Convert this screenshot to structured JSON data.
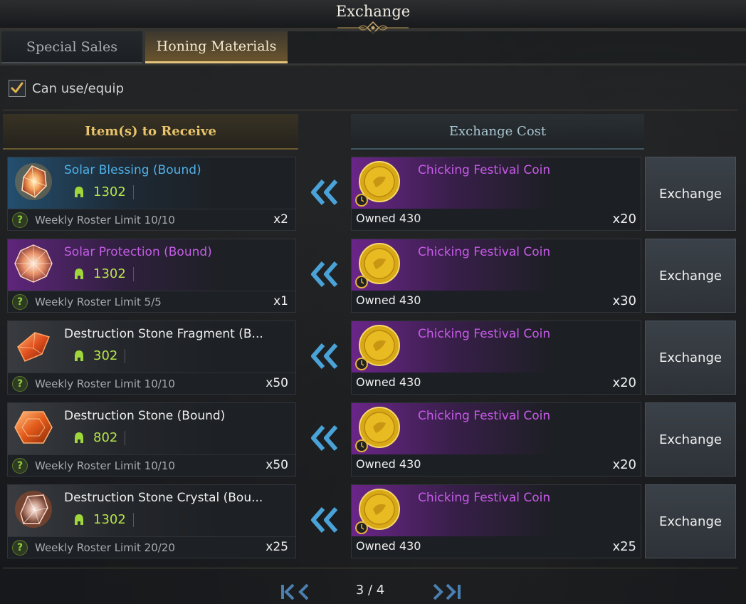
{
  "window": {
    "title": "Exchange"
  },
  "tabs": [
    {
      "label": "Special Sales",
      "active": false
    },
    {
      "label": "Honing Materials",
      "active": true
    }
  ],
  "filter": {
    "label": "Can use/equip",
    "checked": true
  },
  "headers": {
    "receive": "Item(s) to Receive",
    "cost": "Exchange Cost"
  },
  "rows": [
    {
      "item_name": "Solar Blessing (Bound)",
      "name_color": "blue",
      "item_level": "1302",
      "limit": "Weekly Roster Limit 10/10",
      "qty": "x2",
      "icon": "solar-blessing-icon",
      "cost_name": "Chicking Festival Coin",
      "owned": "Owned 430",
      "cost_qty": "x20",
      "button": "Exchange"
    },
    {
      "item_name": "Solar Protection (Bound)",
      "name_color": "purple",
      "item_level": "1302",
      "limit": "Weekly Roster Limit 5/5",
      "qty": "x1",
      "icon": "solar-protection-icon",
      "cost_name": "Chicking Festival Coin",
      "owned": "Owned 430",
      "cost_qty": "x30",
      "button": "Exchange"
    },
    {
      "item_name": "Destruction Stone Fragment (B...",
      "name_color": "white",
      "item_level": "302",
      "limit": "Weekly Roster Limit 10/10",
      "qty": "x50",
      "icon": "destruction-stone-fragment-icon",
      "cost_name": "Chicking Festival Coin",
      "owned": "Owned 430",
      "cost_qty": "x20",
      "button": "Exchange"
    },
    {
      "item_name": "Destruction Stone (Bound)",
      "name_color": "white",
      "item_level": "802",
      "limit": "Weekly Roster Limit 10/10",
      "qty": "x50",
      "icon": "destruction-stone-icon",
      "cost_name": "Chicking Festival Coin",
      "owned": "Owned 430",
      "cost_qty": "x20",
      "button": "Exchange"
    },
    {
      "item_name": "Destruction Stone Crystal (Bou...",
      "name_color": "white",
      "item_level": "1302",
      "limit": "Weekly Roster Limit 20/20",
      "qty": "x25",
      "icon": "destruction-stone-crystal-icon",
      "cost_name": "Chicking Festival Coin",
      "owned": "Owned 430",
      "cost_qty": "x25",
      "button": "Exchange"
    }
  ],
  "pagination": {
    "label": "3 / 4",
    "current": 3,
    "total": 4
  },
  "colors": {
    "accent_gold": "#e9c46a",
    "rarity_blue": "#4fb1e9",
    "rarity_purple": "#c45ee6",
    "item_level_green": "#b6e34a",
    "arrow_blue": "#4aa3d8"
  }
}
